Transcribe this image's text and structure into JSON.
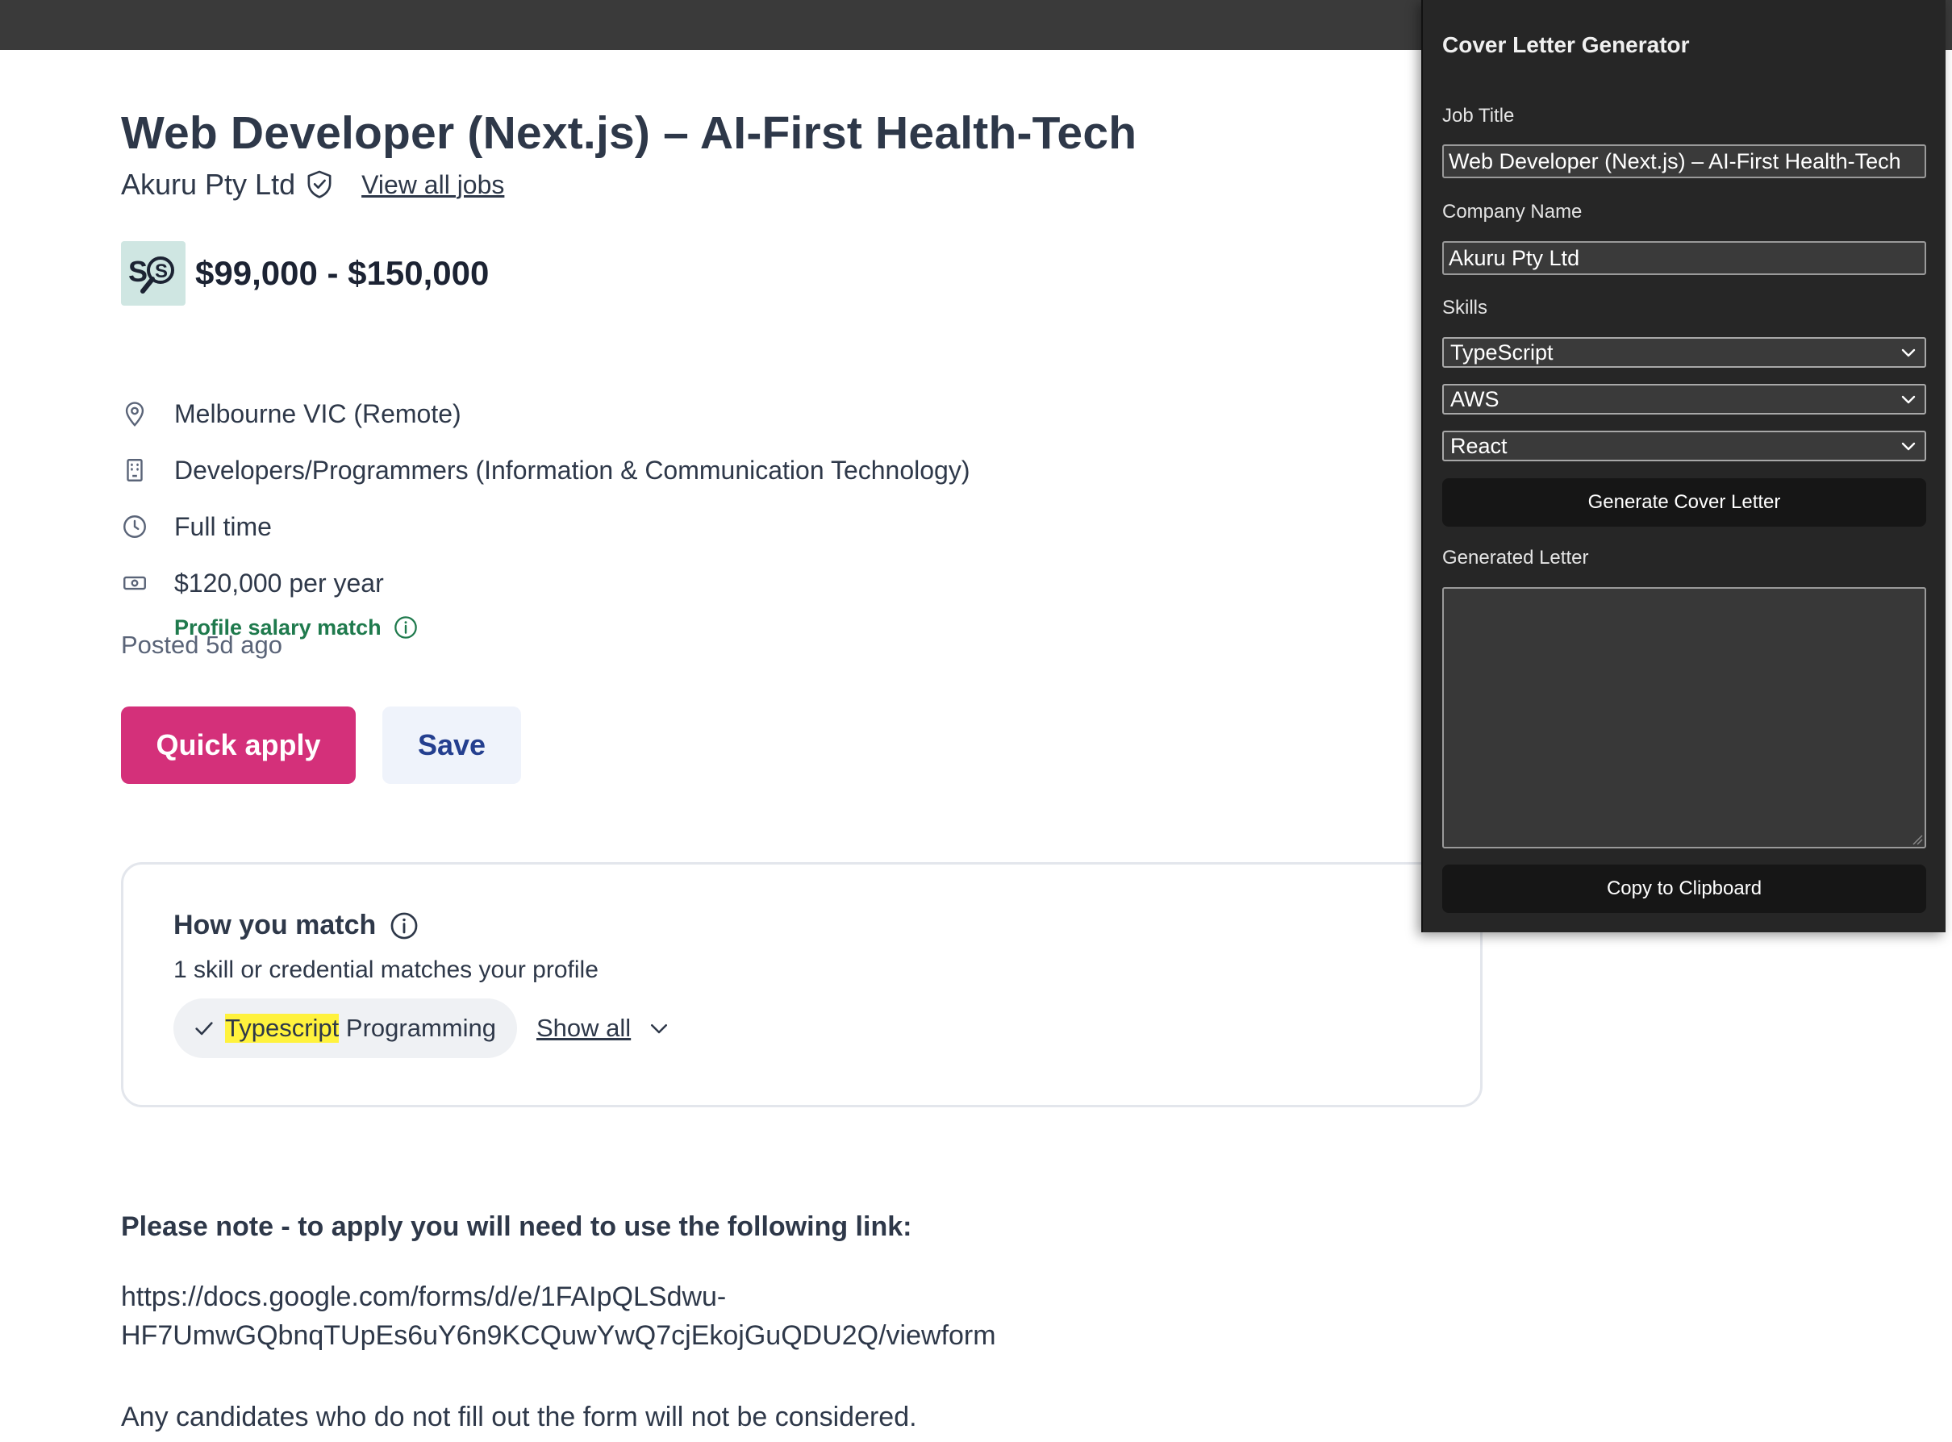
{
  "job": {
    "title": "Web Developer (Next.js) – AI-First Health-Tech",
    "company": "Akuru Pty Ltd",
    "view_all_jobs": "View all jobs",
    "salary_logo_text": "S$",
    "salary_range": "$99,000 - $150,000",
    "location": "Melbourne VIC (Remote)",
    "category": "Developers/Programmers (Information & Communication Technology)",
    "work_type": "Full time",
    "salary": "$120,000 per year",
    "salary_match": "Profile salary match",
    "posted": "Posted 5d ago",
    "quick_apply": "Quick apply",
    "save": "Save"
  },
  "match": {
    "title": "How you match",
    "subtitle": "1 skill or credential matches your profile",
    "skill_highlight": "Typescript",
    "skill_rest": " Programming",
    "show_all": "Show all"
  },
  "note": {
    "heading": "Please note - to apply you will need to use the following link:",
    "link_line1": "https://docs.google.com/forms/d/e/1FAIpQLSdwu-",
    "link_line2": "HF7UmwGQbnqTUpEs6uY6n9KCQuwYwQ7cjEkojGuQDU2Q/viewform",
    "footer": "Any candidates who do not fill out the form will not be considered."
  },
  "panel": {
    "title": "Cover Letter Generator",
    "job_title_label": "Job Title",
    "job_title_value": "Web Developer (Next.js) – AI-First Health-Tech",
    "company_label": "Company Name",
    "company_value": "Akuru Pty Ltd",
    "skills_label": "Skills",
    "skills": [
      "TypeScript",
      "AWS",
      "React"
    ],
    "generate_button": "Generate Cover Letter",
    "generated_label": "Generated Letter",
    "copy_button": "Copy to Clipboard"
  },
  "colors": {
    "quick_apply_bg": "#d4307a",
    "save_text": "#243f8f",
    "salary_match_text": "#1f7a4d",
    "highlight": "#fff23d",
    "panel_bg": "#262626"
  }
}
